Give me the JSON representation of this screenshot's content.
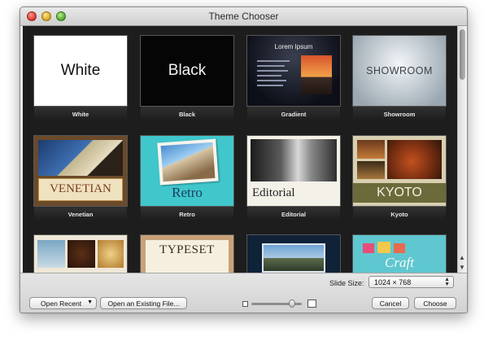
{
  "window": {
    "title": "Theme Chooser"
  },
  "themes": [
    {
      "label": "White",
      "text": "White"
    },
    {
      "label": "Black",
      "text": "Black"
    },
    {
      "label": "Gradient",
      "text": "Lorem Ipsum"
    },
    {
      "label": "Showroom",
      "text": "SHOWROOM"
    },
    {
      "label": "Venetian",
      "text": "VENETIAN"
    },
    {
      "label": "Retro",
      "text": "Retro"
    },
    {
      "label": "Editorial",
      "text": "Editorial"
    },
    {
      "label": "Kyoto",
      "text": "KYOTO"
    },
    {
      "label": "",
      "text": ""
    },
    {
      "label": "",
      "text": "TYPESET"
    },
    {
      "label": "",
      "text": ""
    },
    {
      "label": "",
      "text": "Craft"
    }
  ],
  "bottom_bar": {
    "slide_size_label": "Slide Size:",
    "slide_size_value": "1024 × 768",
    "open_recent": "Open Recent",
    "open_existing": "Open an Existing File...",
    "cancel": "Cancel",
    "choose": "Choose"
  },
  "icons": {
    "close": "close-icon",
    "minimize": "minimize-icon",
    "zoom": "zoom-icon",
    "dropdown": "chevron-down-icon",
    "stepper": "up-down-arrows-icon",
    "small_thumb": "small-thumbnail-icon",
    "large_thumb": "large-thumbnail-icon"
  },
  "zoom_slider": {
    "value_fraction": 0.72
  }
}
